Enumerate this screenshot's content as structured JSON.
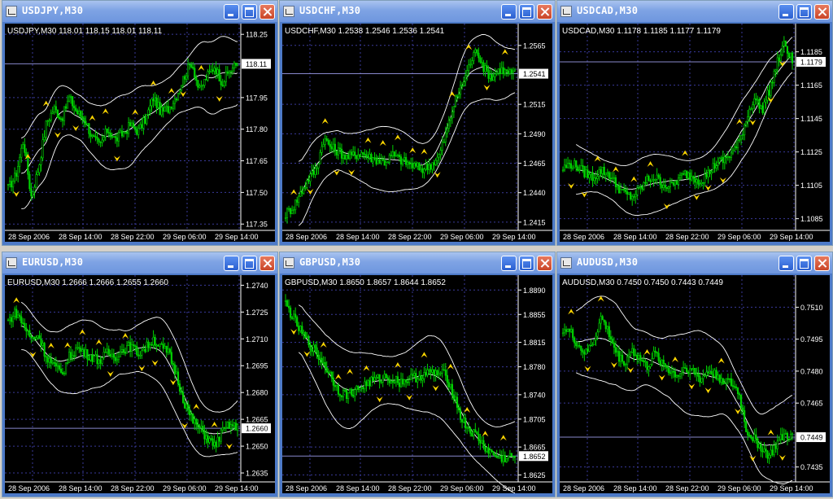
{
  "colors": {
    "candle": "#00d000",
    "band": "#ffffff",
    "arrow": "#ffd700",
    "grid": "#3a3a9a",
    "background": "#000000",
    "priceline": "#8888cc"
  },
  "icons": {
    "window_icon": "chart-window-icon",
    "minimize": "minimize-icon",
    "maximize": "maximize-icon",
    "close": "close-icon"
  },
  "windows": [
    {
      "title": "USDJPY,M30",
      "header": "USDJPY,M30  118.01 118.15 118.01 118.11",
      "current_price": "118.11",
      "x_ticks": [
        "28 Sep 2006",
        "28 Sep 14:00",
        "28 Sep 22:00",
        "29 Sep 06:00",
        "29 Sep 14:00"
      ],
      "y_ticks": [
        "118.25",
        "118.11",
        "117.95",
        "117.80",
        "117.65",
        "117.50",
        "117.35"
      ],
      "chart_data": {
        "type": "candlestick",
        "ylim": [
          117.32,
          118.27
        ],
        "current": 118.11,
        "y_ticks": [
          118.25,
          117.95,
          117.8,
          117.65,
          117.5,
          117.35
        ],
        "keypoints": [
          117.52,
          117.58,
          117.75,
          117.48,
          117.62,
          117.83,
          117.9,
          117.85,
          117.95,
          117.88,
          117.85,
          117.76,
          117.72,
          117.8,
          117.75,
          117.78,
          117.82,
          117.79,
          117.85,
          117.95,
          117.88,
          117.9,
          117.96,
          118.05,
          118.12,
          117.98,
          118.05,
          118.1,
          118.02,
          118.08,
          118.11
        ],
        "band_width": 0.14
      }
    },
    {
      "title": "USDCHF,M30",
      "header": "USDCHF,M30  1.2538 1.2546 1.2536 1.2541",
      "current_price": "1.2541",
      "x_ticks": [
        "28 Sep 2006",
        "28 Sep 14:00",
        "28 Sep 22:00",
        "29 Sep 06:00",
        "29 Sep 14:00"
      ],
      "y_ticks": [
        "1.2565",
        "1.2541",
        "1.2515",
        "1.2490",
        "1.2465",
        "1.2440",
        "1.2415"
      ],
      "chart_data": {
        "type": "candlestick",
        "ylim": [
          1.2408,
          1.2578
        ],
        "current": 1.2541,
        "y_ticks": [
          1.2565,
          1.2515,
          1.249,
          1.2465,
          1.244,
          1.2415
        ],
        "keypoints": [
          1.2422,
          1.2428,
          1.244,
          1.2452,
          1.246,
          1.2486,
          1.2478,
          1.2475,
          1.247,
          1.2472,
          1.2474,
          1.247,
          1.2468,
          1.2466,
          1.2472,
          1.2468,
          1.2465,
          1.2462,
          1.246,
          1.2464,
          1.247,
          1.249,
          1.2515,
          1.253,
          1.2548,
          1.2562,
          1.2545,
          1.2538,
          1.2545,
          1.2542,
          1.2541
        ],
        "band_width": 0.0022
      }
    },
    {
      "title": "USDCAD,M30",
      "header": "USDCAD,M30  1.1178 1.1185 1.1177 1.1179",
      "current_price": "1.1179",
      "x_ticks": [
        "28 Sep 2006",
        "28 Sep 14:00",
        "28 Sep 22:00",
        "29 Sep 06:00",
        "29 Sep 14:00"
      ],
      "y_ticks": [
        "1.1185",
        "1.1179",
        "1.1165",
        "1.1145",
        "1.1125",
        "1.1105",
        "1.1085"
      ],
      "chart_data": {
        "type": "candlestick",
        "ylim": [
          1.1078,
          1.1198
        ],
        "current": 1.1179,
        "y_ticks": [
          1.1185,
          1.1165,
          1.1145,
          1.1125,
          1.1105,
          1.1085
        ],
        "keypoints": [
          1.1115,
          1.1118,
          1.1116,
          1.1112,
          1.111,
          1.1114,
          1.1112,
          1.1105,
          1.11,
          1.1098,
          1.1102,
          1.1108,
          1.111,
          1.1106,
          1.1104,
          1.1108,
          1.1112,
          1.111,
          1.1108,
          1.1112,
          1.1118,
          1.112,
          1.1124,
          1.113,
          1.1145,
          1.1158,
          1.115,
          1.1162,
          1.1178,
          1.119,
          1.1179
        ],
        "band_width": 0.0014
      }
    },
    {
      "title": "EURUSD,M30",
      "header": "EURUSD,M30  1.2666 1.2666 1.2655 1.2660",
      "current_price": "1.2660",
      "x_ticks": [
        "28 Sep 2006",
        "28 Sep 14:00",
        "28 Sep 22:00",
        "29 Sep 06:00",
        "29 Sep 14:00"
      ],
      "y_ticks": [
        "1.2740",
        "1.2725",
        "1.2710",
        "1.2695",
        "1.2680",
        "1.2665",
        "1.2660",
        "1.2650",
        "1.2635"
      ],
      "chart_data": {
        "type": "candlestick",
        "ylim": [
          1.263,
          1.2742
        ],
        "current": 1.266,
        "y_ticks": [
          1.274,
          1.2725,
          1.271,
          1.2695,
          1.268,
          1.2665,
          1.265,
          1.2635
        ],
        "keypoints": [
          1.272,
          1.2725,
          1.2718,
          1.271,
          1.2712,
          1.27,
          1.2695,
          1.269,
          1.27,
          1.2705,
          1.2702,
          1.27,
          1.2698,
          1.2702,
          1.27,
          1.2704,
          1.2706,
          1.2702,
          1.2705,
          1.271,
          1.2705,
          1.2702,
          1.269,
          1.2675,
          1.2665,
          1.266,
          1.2655,
          1.265,
          1.2658,
          1.2662,
          1.266
        ],
        "band_width": 0.0016
      }
    },
    {
      "title": "GBPUSD,M30",
      "header": "GBPUSD,M30  1.8650 1.8657 1.8644 1.8652",
      "current_price": "1.8652",
      "x_ticks": [
        "28 Sep 2006",
        "28 Sep 14:00",
        "28 Sep 22:00",
        "29 Sep 06:00",
        "29 Sep 14:00"
      ],
      "y_ticks": [
        "1.8890",
        "1.8855",
        "1.8815",
        "1.8780",
        "1.8740",
        "1.8705",
        "1.8665",
        "1.8652",
        "1.8625"
      ],
      "chart_data": {
        "type": "candlestick",
        "ylim": [
          1.8615,
          1.8902
        ],
        "current": 1.8652,
        "y_ticks": [
          1.889,
          1.8855,
          1.8815,
          1.878,
          1.874,
          1.8705,
          1.8665,
          1.8625
        ],
        "keypoints": [
          1.887,
          1.885,
          1.883,
          1.8815,
          1.88,
          1.8785,
          1.8765,
          1.8745,
          1.874,
          1.8745,
          1.8752,
          1.8758,
          1.8762,
          1.8765,
          1.8762,
          1.8758,
          1.8762,
          1.8765,
          1.8768,
          1.8772,
          1.877,
          1.8768,
          1.874,
          1.8705,
          1.869,
          1.868,
          1.8665,
          1.8655,
          1.8648,
          1.865,
          1.8652
        ],
        "band_width": 0.0045
      }
    },
    {
      "title": "AUDUSD,M30",
      "header": "AUDUSD,M30  0.7450 0.7450 0.7443 0.7449",
      "current_price": "0.7449",
      "x_ticks": [
        "28 Sep 2006",
        "28 Sep 14:00",
        "28 Sep 22:00",
        "29 Sep 06:00",
        "29 Sep 14:00"
      ],
      "y_ticks": [
        "0.7510",
        "0.7495",
        "0.7480",
        "0.7465",
        "0.7449",
        "0.7435"
      ],
      "chart_data": {
        "type": "candlestick",
        "ylim": [
          0.7428,
          0.7522
        ],
        "current": 0.7449,
        "y_ticks": [
          0.751,
          0.7495,
          0.748,
          0.7465,
          0.7435
        ],
        "keypoints": [
          0.75,
          0.7498,
          0.7492,
          0.7488,
          0.7494,
          0.7505,
          0.7498,
          0.7488,
          0.7484,
          0.749,
          0.7486,
          0.7482,
          0.7488,
          0.7484,
          0.748,
          0.7478,
          0.7482,
          0.748,
          0.7476,
          0.748,
          0.7478,
          0.7476,
          0.7474,
          0.747,
          0.7452,
          0.7448,
          0.7444,
          0.744,
          0.7446,
          0.745,
          0.7449
        ],
        "band_width": 0.0016
      }
    }
  ]
}
